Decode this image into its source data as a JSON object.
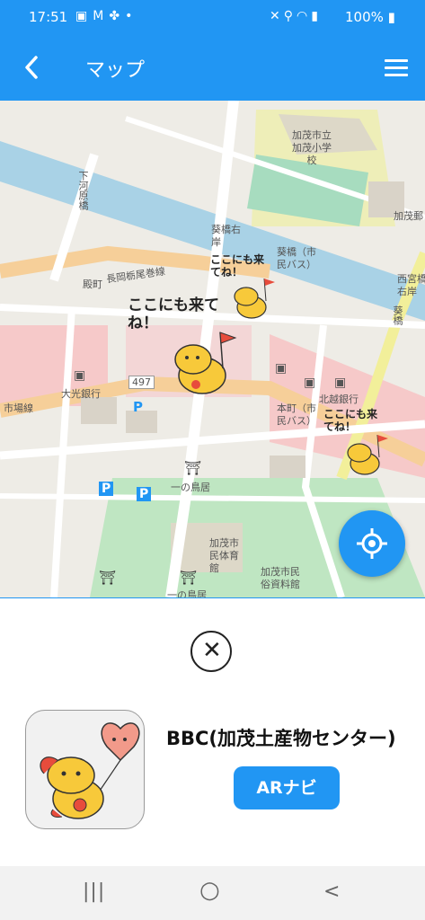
{
  "status_bar": {
    "time": "17:51",
    "left_icons": [
      "image-icon",
      "gmail-icon",
      "fan-icon",
      "dot-icon"
    ],
    "right_icons": [
      "mute-icon",
      "location-icon",
      "wifi-icon",
      "signal-icon"
    ],
    "battery": "100%"
  },
  "app_bar": {
    "title": "マップ"
  },
  "map": {
    "labels": {
      "school": "加茂市立\n加茂小学\n校",
      "shimokawara": "下河原橋",
      "aoi_bridge_right": "葵橋右\n岸",
      "aoi_bridge_bus": "葵橋（市\n民バス）",
      "nagaoka_line": "長岡栃尾巻線",
      "tonomachi": "殿町",
      "route": "497",
      "bank": "大光銀行",
      "shijo_line": "市場線",
      "honmachi": "本町（市\n民バス）",
      "hokuetsu_bank": "北越銀行",
      "ichinotorii": "一の鳥居",
      "ichinotorii2": "一の鳥居",
      "gym": "加茂市\n民体育\n館",
      "museum": "加茂市民\n俗資料館",
      "nishimiya": "西宮橋\n右岸",
      "aoi_bridge_v": "葵橋",
      "kamo_post": "加茂郵"
    },
    "callouts": [
      "ここにも来てね！",
      "ここにも来てね！",
      "ここにも来てね！"
    ],
    "parking_label": "P",
    "colors": {
      "river": "#a9d2e6",
      "main_road": "#f6cf99",
      "yellow_road": "#f2ef9a",
      "commercial": "#f6c9c9",
      "park": "#bfe6c2",
      "school_area": "#eeeeb8"
    }
  },
  "locate_button": {
    "icon": "crosshair-icon"
  },
  "close_button": {
    "icon": "close-icon"
  },
  "place": {
    "name": "BBC(加茂土産物センター)",
    "ar_button_label": "ARナビ"
  },
  "nav_bar": {
    "recents": "|||",
    "home": "○",
    "back": "<"
  }
}
